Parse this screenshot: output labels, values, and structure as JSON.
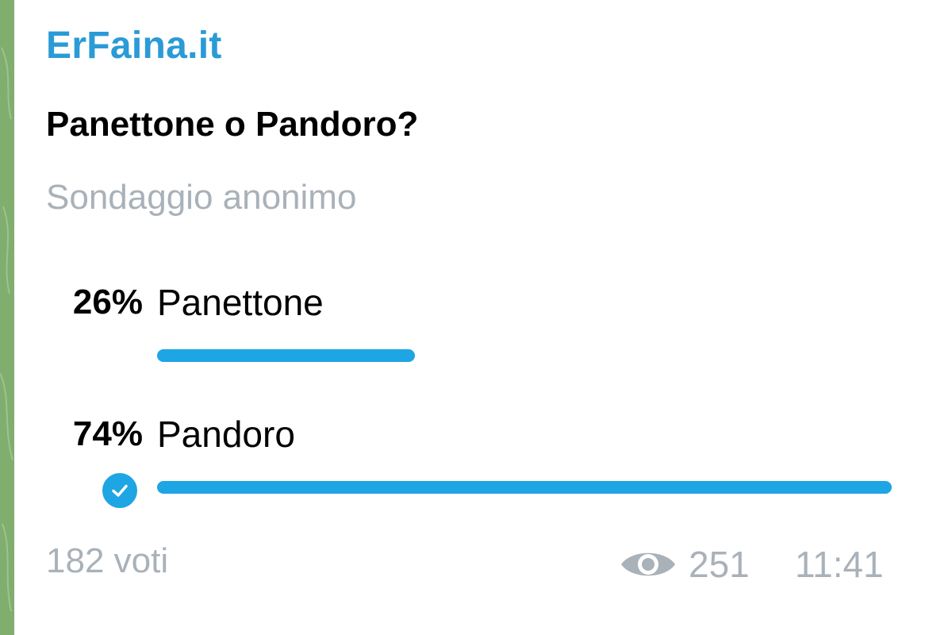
{
  "message": {
    "channel_name": "ErFaina.it",
    "poll": {
      "question": "Panettone o Pandoro?",
      "type_label": "Sondaggio anonimo",
      "options": [
        {
          "percent_label": "26%",
          "label": "Panettone",
          "fraction": 0.26,
          "chosen": false
        },
        {
          "percent_label": "74%",
          "label": "Pandoro",
          "fraction": 0.74,
          "chosen": true
        }
      ],
      "total_votes_label": "182 voti"
    },
    "views": "251",
    "time": "11:41",
    "view_icon": "eye-icon",
    "chosen_icon": "check-circle-icon"
  },
  "colors": {
    "accent": "#1ea5e3",
    "channel_name": "#2a9bd6",
    "muted_text": "#a9b1b9",
    "wallpaper": "#7fae6f"
  }
}
